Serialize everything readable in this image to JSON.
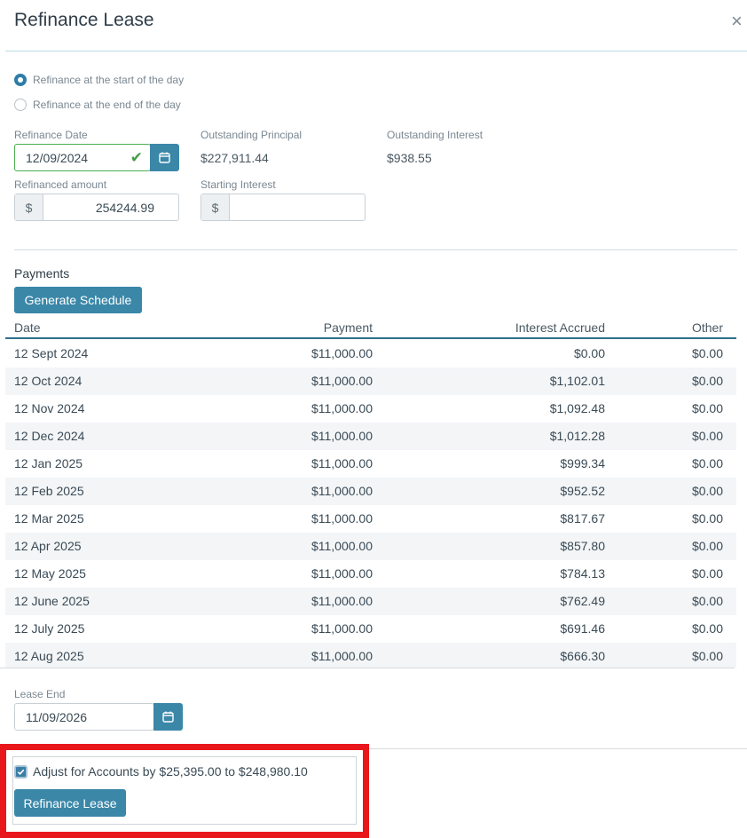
{
  "dialog": {
    "title": "Refinance Lease",
    "close_glyph": "×"
  },
  "options": {
    "start_of_day": "Refinance at the start of the day",
    "end_of_day": "Refinance at the end of the day",
    "selected": "start_of_day"
  },
  "fields": {
    "refinance_date_label": "Refinance Date",
    "refinance_date_value": "12/09/2024",
    "outstanding_principal_label": "Outstanding Principal",
    "outstanding_principal_value": "$227,911.44",
    "outstanding_interest_label": "Outstanding Interest",
    "outstanding_interest_value": "$938.55",
    "refinanced_amount_label": "Refinanced amount",
    "refinanced_amount_value": "254244.99",
    "starting_interest_label": "Starting Interest",
    "starting_interest_value": "",
    "currency_symbol": "$"
  },
  "payments": {
    "section_title": "Payments",
    "generate_button": "Generate Schedule",
    "columns": [
      "Date",
      "Payment",
      "Interest Accrued",
      "Other"
    ],
    "rows": [
      [
        "12 Sept 2024",
        "$11,000.00",
        "$0.00",
        "$0.00"
      ],
      [
        "12 Oct 2024",
        "$11,000.00",
        "$1,102.01",
        "$0.00"
      ],
      [
        "12 Nov 2024",
        "$11,000.00",
        "$1,092.48",
        "$0.00"
      ],
      [
        "12 Dec 2024",
        "$11,000.00",
        "$1,012.28",
        "$0.00"
      ],
      [
        "12 Jan 2025",
        "$11,000.00",
        "$999.34",
        "$0.00"
      ],
      [
        "12 Feb 2025",
        "$11,000.00",
        "$952.52",
        "$0.00"
      ],
      [
        "12 Mar 2025",
        "$11,000.00",
        "$817.67",
        "$0.00"
      ],
      [
        "12 Apr 2025",
        "$11,000.00",
        "$857.80",
        "$0.00"
      ],
      [
        "12 May 2025",
        "$11,000.00",
        "$784.13",
        "$0.00"
      ],
      [
        "12 June 2025",
        "$11,000.00",
        "$762.49",
        "$0.00"
      ],
      [
        "12 July 2025",
        "$11,000.00",
        "$691.46",
        "$0.00"
      ],
      [
        "12 Aug 2025",
        "$11,000.00",
        "$666.30",
        "$0.00"
      ]
    ]
  },
  "lease_end": {
    "label": "Lease End",
    "value": "11/09/2026"
  },
  "footer": {
    "adjust_label": "Adjust for Accounts by $25,395.00 to $248,980.10",
    "adjust_checked": true,
    "refinance_button": "Refinance Lease"
  },
  "icons": {
    "calendar": "calendar-icon",
    "check": "checkmark-icon",
    "close": "close-icon"
  },
  "colors": {
    "accent": "#3a87a8",
    "valid": "#4caf50",
    "highlight": "#e8171c"
  }
}
